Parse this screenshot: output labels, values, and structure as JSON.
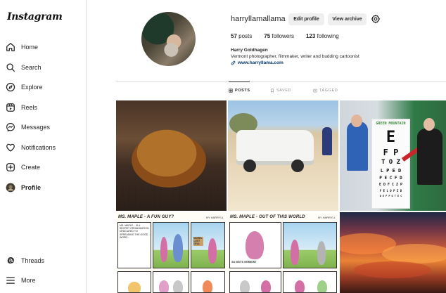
{
  "sidebar": {
    "logo": "Instagram",
    "items": [
      {
        "label": "Home",
        "icon": "home-icon"
      },
      {
        "label": "Search",
        "icon": "search-icon"
      },
      {
        "label": "Explore",
        "icon": "compass-icon"
      },
      {
        "label": "Reels",
        "icon": "reels-icon"
      },
      {
        "label": "Messages",
        "icon": "messenger-icon"
      },
      {
        "label": "Notifications",
        "icon": "heart-icon"
      },
      {
        "label": "Create",
        "icon": "plus-square-icon"
      },
      {
        "label": "Profile",
        "icon": "profile-avatar-icon"
      }
    ],
    "bottom_items": [
      {
        "label": "Threads",
        "icon": "threads-icon"
      },
      {
        "label": "More",
        "icon": "hamburger-menu-icon"
      }
    ]
  },
  "profile": {
    "username": "harryllamallama",
    "edit_button": "Edit profile",
    "archive_button": "View archive",
    "stats": {
      "posts_count": "57",
      "posts_label": "posts",
      "followers_count": "75",
      "followers_label": "followers",
      "following_count": "123",
      "following_label": "following"
    },
    "full_name": "Harry Goldhagen",
    "bio": "Vermont photographer, filmmaker, writer and budding cartoonist",
    "website": "www.harryllama.com"
  },
  "tabs": [
    {
      "label": "POSTS",
      "icon": "grid-icon",
      "active": true
    },
    {
      "label": "SAVED",
      "icon": "bookmark-icon",
      "active": false
    },
    {
      "label": "TAGGED",
      "icon": "tag-icon",
      "active": false
    }
  ],
  "posts": {
    "comic1": {
      "title": "MS. MAPLE - A FUN GUY?",
      "byline": "BY HARRYLL",
      "panel_text": "MS. MAPLE... IS A SECRET ORGANIZATION DEDICATED TO SPREADING THE GOOD WORD...",
      "sign_text": "MOREL LUST DEAL"
    },
    "comic2": {
      "title": "MS. MAPLE - OUT OF THIS WORLD",
      "byline": "BY HARRYLL",
      "caption": "3/4 VISITS VERMONT"
    },
    "eye_chart": {
      "line1": "E",
      "line2": "F P",
      "line3": "T O Z",
      "line4": "L P E D",
      "line5": "P E C F D",
      "line6": "E D F C Z P",
      "line7": "F E L O P Z D",
      "line8": "D E F P O T E C",
      "sign": "GREEN MOUNTAIN"
    }
  },
  "colors": {
    "text": "#262626",
    "border": "#dbdbdb",
    "button_bg": "#efefef",
    "link": "#00376b",
    "muted": "#8e8e8e"
  }
}
